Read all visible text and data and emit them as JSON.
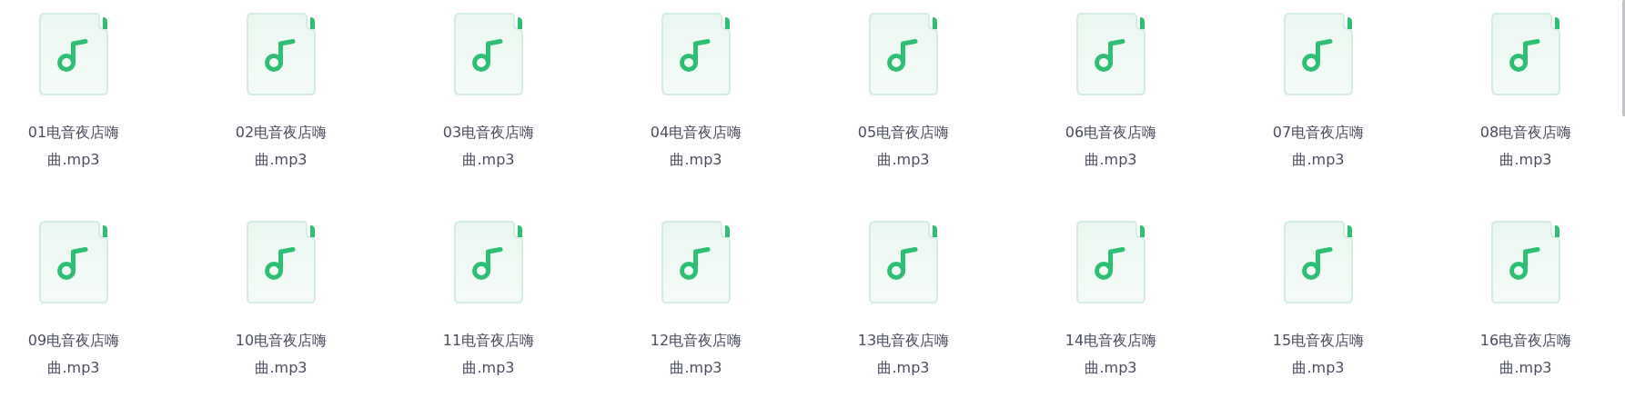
{
  "files": [
    {
      "name": "01电音夜店嗨曲.mp3"
    },
    {
      "name": "02电音夜店嗨曲.mp3"
    },
    {
      "name": "03电音夜店嗨曲.mp3"
    },
    {
      "name": "04电音夜店嗨曲.mp3"
    },
    {
      "name": "05电音夜店嗨曲.mp3"
    },
    {
      "name": "06电音夜店嗨曲.mp3"
    },
    {
      "name": "07电音夜店嗨曲.mp3"
    },
    {
      "name": "08电音夜店嗨曲.mp3"
    },
    {
      "name": "09电音夜店嗨曲.mp3"
    },
    {
      "name": "10电音夜店嗨曲.mp3"
    },
    {
      "name": "11电音夜店嗨曲.mp3"
    },
    {
      "name": "12电音夜店嗨曲.mp3"
    },
    {
      "name": "13电音夜店嗨曲.mp3"
    },
    {
      "name": "14电音夜店嗨曲.mp3"
    },
    {
      "name": "15电音夜店嗨曲.mp3"
    },
    {
      "name": "16电音夜店嗨曲.mp3"
    }
  ]
}
